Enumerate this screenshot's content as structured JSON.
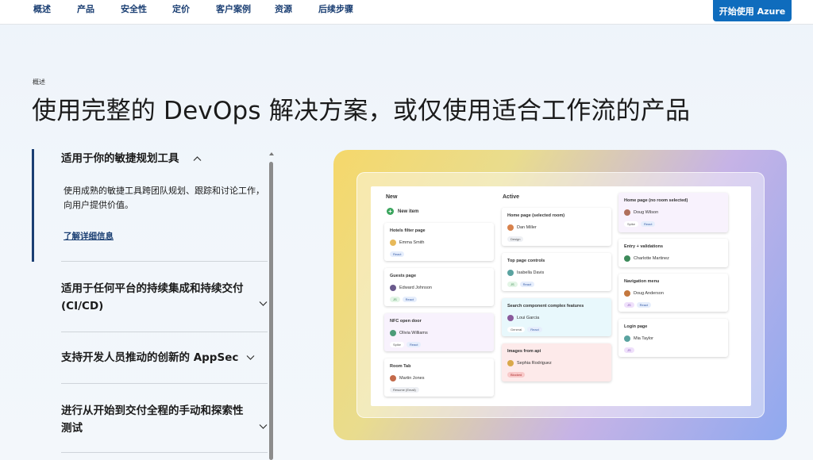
{
  "nav": {
    "items": [
      "概述",
      "产品",
      "安全性",
      "定价",
      "客户案例",
      "资源",
      "后续步骤"
    ],
    "cta_label": "开始使用 Azure"
  },
  "hero": {
    "eyebrow": "概述",
    "title": "使用完整的 DevOps 解决方案，或仅使用适合工作流的产品"
  },
  "accordion": {
    "active": {
      "title": "适用于你的敏捷规划工具",
      "description": "使用成熟的敏捷工具跨团队规划、跟踪和讨论工作，向用户提供价值。",
      "link": "了解详细信息"
    },
    "collapsed": [
      "适用于任何平台的持续集成和持续交付 (CI/CD)",
      "支持开发人员推动的创新的 AppSec",
      "进行从开始到交付全程的手动和探索性测试"
    ]
  },
  "board": {
    "columns": [
      "New",
      "Active"
    ],
    "new_item_label": "New item",
    "cards": [
      {
        "title": "Hotels filter page",
        "person": "Emma Smith",
        "tags": [
          "React"
        ]
      },
      {
        "title": "Guests page",
        "person": "Edward Johnson",
        "tags": [
          "JS",
          "React"
        ]
      },
      {
        "title": "NFC open door",
        "person": "Olivia Williams",
        "tags": [
          "Spike",
          "React"
        ]
      },
      {
        "title": "Room Tab",
        "person": "Martin Jones",
        "tags": [
          "Resume (Email)"
        ]
      },
      {
        "title": "Home page (selected room)",
        "person": "Dan Miller",
        "tags": [
          "Design"
        ]
      },
      {
        "title": "Top page controls",
        "person": "Isabella Davis",
        "tags": [
          "JS",
          "React"
        ]
      },
      {
        "title": "Search component complex features",
        "person": "Loui Garcia",
        "tags": [
          "General",
          "React"
        ]
      },
      {
        "title": "Images from api",
        "person": "Sephia Rodriguez",
        "tags": [
          "Blocked"
        ]
      },
      {
        "title": "Home page (no room selected)",
        "person": "Doug Wilson",
        "tags": [
          "Spike",
          "React"
        ]
      },
      {
        "title": "Entry + validations",
        "person": "Charlotte Martinez",
        "tags": []
      },
      {
        "title": "Navigation menu",
        "person": "Doug Anderson",
        "tags": [
          "JS",
          "React"
        ]
      },
      {
        "title": "Login page",
        "person": "Mia Taylor",
        "tags": [
          "JS"
        ]
      }
    ]
  },
  "colors": {
    "nav_text": "#1b3f73",
    "cta_bg": "#0f6cbd",
    "accent_border": "#1b3f73"
  }
}
